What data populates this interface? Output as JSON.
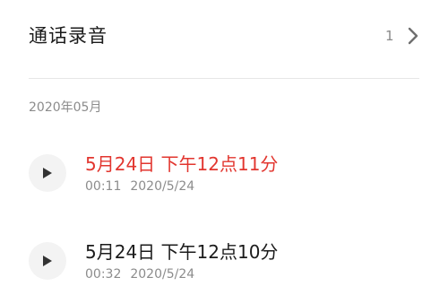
{
  "header": {
    "title": "通话录音",
    "count": "1"
  },
  "section": {
    "date": "2020年05月"
  },
  "records": [
    {
      "title": "5月24日 下午12点11分",
      "duration": "00:11",
      "date": "2020/5/24",
      "highlight": true,
      "title_color": "#e2362f"
    },
    {
      "title": "5月24日 下午12点10分",
      "duration": "00:32",
      "date": "2020/5/24",
      "highlight": false,
      "title_color": "#1b1b1b"
    }
  ],
  "icons": {
    "header_arrow": "chevron-right-icon",
    "play": "play-icon"
  }
}
